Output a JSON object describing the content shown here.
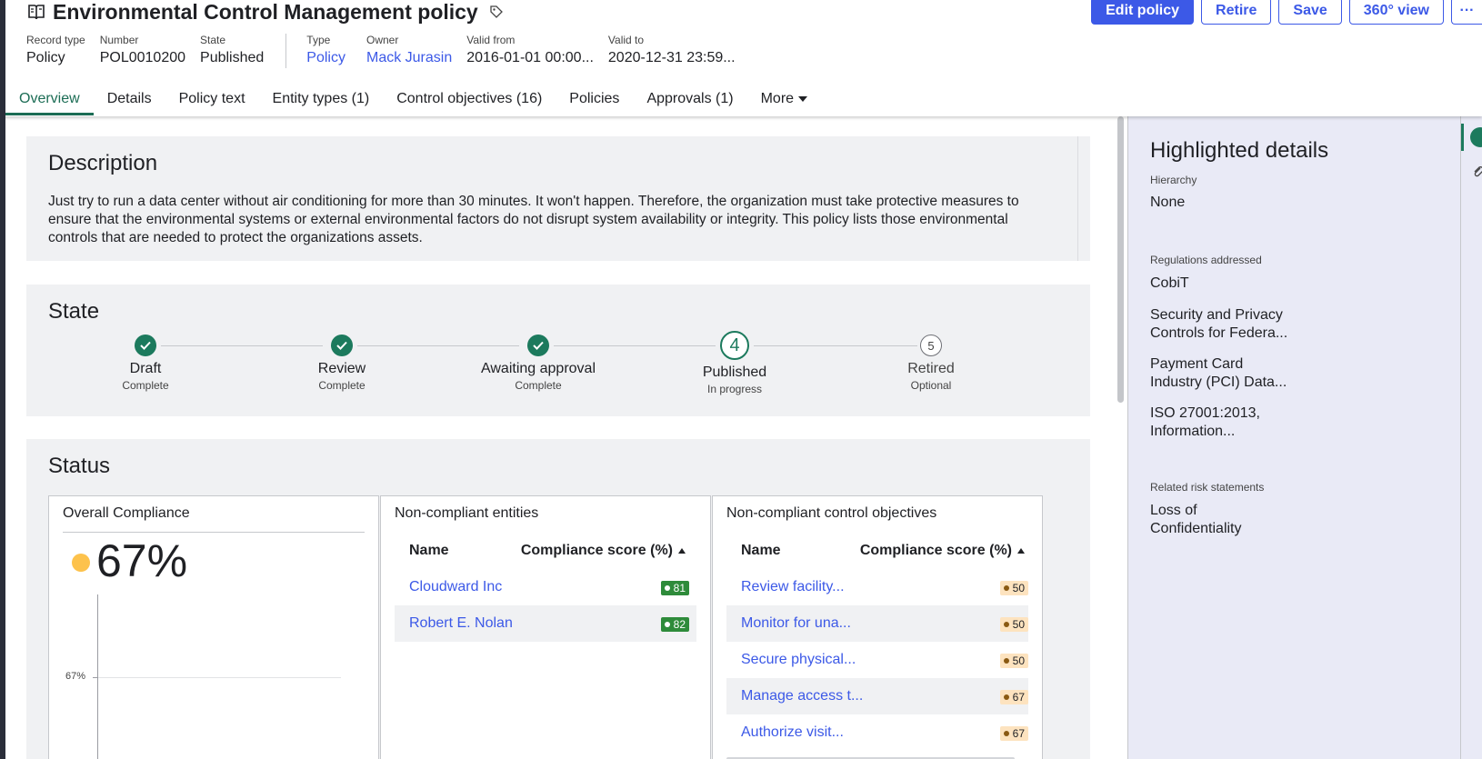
{
  "header": {
    "title": "Environmental Control Management policy",
    "actions": {
      "edit": "Edit policy",
      "retire": "Retire",
      "save": "Save",
      "view360": "360° view",
      "more": "···"
    },
    "meta": {
      "record_type": {
        "label": "Record type",
        "value": "Policy"
      },
      "number": {
        "label": "Number",
        "value": "POL0010200"
      },
      "state": {
        "label": "State",
        "value": "Published"
      },
      "type": {
        "label": "Type",
        "value": "Policy"
      },
      "owner": {
        "label": "Owner",
        "value": "Mack Jurasin"
      },
      "valid_from": {
        "label": "Valid from",
        "value": "2016-01-01 00:00..."
      },
      "valid_to": {
        "label": "Valid to",
        "value": "2020-12-31 23:59..."
      }
    },
    "tabs": [
      {
        "label": "Overview",
        "active": true
      },
      {
        "label": "Details"
      },
      {
        "label": "Policy text"
      },
      {
        "label": "Entity types (1)"
      },
      {
        "label": "Control objectives (16)"
      },
      {
        "label": "Policies"
      },
      {
        "label": "Approvals (1)"
      },
      {
        "label": "More"
      }
    ]
  },
  "description": {
    "title": "Description",
    "text": "Just try to run a data center without air conditioning for more than 30 minutes. It won't happen. Therefore, the organization must take protective measures to ensure that the environmental systems or external environmental factors do not disrupt system availability or integrity. This policy lists those environmental controls that are needed to protect the organizations assets."
  },
  "state": {
    "title": "State",
    "steps": [
      {
        "label": "Draft",
        "sub": "Complete",
        "status": "done"
      },
      {
        "label": "Review",
        "sub": "Complete",
        "status": "done"
      },
      {
        "label": "Awaiting approval",
        "sub": "Complete",
        "status": "done"
      },
      {
        "label": "Published",
        "sub": "In progress",
        "status": "current",
        "number": "4"
      },
      {
        "label": "Retired",
        "sub": "Optional",
        "status": "future",
        "number": "5"
      }
    ]
  },
  "status": {
    "title": "Status",
    "overall": {
      "title": "Overall Compliance",
      "value": "67%",
      "tick_label": "67%",
      "indicator_color": "#fdc24c"
    },
    "entities": {
      "title": "Non-compliant entities",
      "col_name": "Name",
      "col_score": "Compliance score (%)",
      "rows": [
        {
          "name": "Cloudward Inc",
          "score": "81"
        },
        {
          "name": "Robert E. Nolan",
          "score": "82"
        }
      ]
    },
    "objectives": {
      "title": "Non-compliant control objectives",
      "col_name": "Name",
      "col_score": "Compliance score (%)",
      "rows": [
        {
          "name": "Review facility...",
          "score": "50"
        },
        {
          "name": "Monitor for una...",
          "score": "50"
        },
        {
          "name": "Secure physical...",
          "score": "50"
        },
        {
          "name": "Manage access t...",
          "score": "67"
        },
        {
          "name": "Authorize visit...",
          "score": "67"
        }
      ]
    }
  },
  "sidebar": {
    "title": "Highlighted details",
    "hierarchy": {
      "label": "Hierarchy",
      "value": "None"
    },
    "regulations": {
      "label": "Regulations addressed",
      "items": [
        "CobiT",
        "Security and Privacy Controls for Federa...",
        "Payment Card Industry (PCI) Data...",
        "ISO 27001:2013, Information..."
      ]
    },
    "risks": {
      "label": "Related risk statements",
      "value": "Loss of Confidentiality"
    }
  },
  "colors": {
    "accent": "#3c59e7",
    "green": "#1c7a5d",
    "good_badge": "#2e8b3a",
    "warn_badge": "#fde3bf"
  },
  "icons": {
    "title": "policy-book-icon",
    "tag": "tag-icon",
    "step_done": "check-icon",
    "tab_more": "caret-down-icon",
    "sort": "sort-ascending-icon",
    "rail_info": "info-icon",
    "rail_attach": "paperclip-icon"
  }
}
